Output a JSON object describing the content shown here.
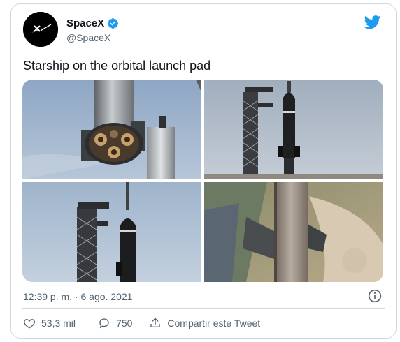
{
  "author": {
    "name": "SpaceX",
    "handle": "@SpaceX",
    "verified": true,
    "avatar_icon": "spacex-logo-icon"
  },
  "brand_color": "#1d9bf0",
  "tweet": {
    "text": "Starship on the orbital launch pad"
  },
  "media": [
    {
      "name": "photo-booster-engines",
      "icon": "photo"
    },
    {
      "name": "photo-tower-and-ship",
      "icon": "photo"
    },
    {
      "name": "photo-tower-closeup",
      "icon": "photo"
    },
    {
      "name": "photo-aerial-view",
      "icon": "photo"
    }
  ],
  "timestamp": "12:39 p. m. · 6 ago. 2021",
  "actions": {
    "likes": "53,3 mil",
    "replies": "750",
    "share_label": "Compartir este Tweet"
  }
}
